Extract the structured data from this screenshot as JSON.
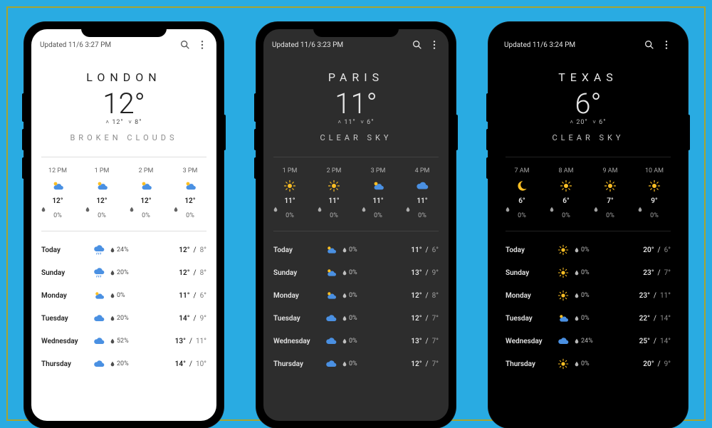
{
  "colors": {
    "bg": "#29abe2",
    "border": "#a8a430"
  },
  "phones": [
    {
      "theme": "light",
      "updated": "Updated 11/6 3:27 PM",
      "city": "LONDON",
      "temp": "12°",
      "hi": "12°",
      "lo": "8°",
      "condition": "BROKEN CLOUDS",
      "hourly": [
        {
          "time": "12 PM",
          "icon": "partly",
          "temp": "12°",
          "precip": "0%"
        },
        {
          "time": "1 PM",
          "icon": "partly",
          "temp": "12°",
          "precip": "0%"
        },
        {
          "time": "2 PM",
          "icon": "partly",
          "temp": "12°",
          "precip": "0%"
        },
        {
          "time": "3 PM",
          "icon": "partly",
          "temp": "12°",
          "precip": "0%"
        }
      ],
      "daily": [
        {
          "day": "Today",
          "icon": "rain",
          "precip": "24%",
          "hi": "12°",
          "lo": "8°"
        },
        {
          "day": "Sunday",
          "icon": "rain",
          "precip": "20%",
          "hi": "12°",
          "lo": "8°"
        },
        {
          "day": "Monday",
          "icon": "partly",
          "precip": "0%",
          "hi": "11°",
          "lo": "6°"
        },
        {
          "day": "Tuesday",
          "icon": "cloud",
          "precip": "20%",
          "hi": "14°",
          "lo": "9°"
        },
        {
          "day": "Wednesday",
          "icon": "cloud",
          "precip": "52%",
          "hi": "13°",
          "lo": "11°"
        },
        {
          "day": "Thursday",
          "icon": "cloud",
          "precip": "20%",
          "hi": "14°",
          "lo": "10°"
        }
      ]
    },
    {
      "theme": "dark",
      "updated": "Updated 11/6 3:23 PM",
      "city": "PARIS",
      "temp": "11°",
      "hi": "11°",
      "lo": "6°",
      "condition": "CLEAR SKY",
      "hourly": [
        {
          "time": "1 PM",
          "icon": "sun",
          "temp": "11°",
          "precip": "0%"
        },
        {
          "time": "2 PM",
          "icon": "sun",
          "temp": "11°",
          "precip": "0%"
        },
        {
          "time": "3 PM",
          "icon": "partly",
          "temp": "11°",
          "precip": "0%"
        },
        {
          "time": "4 PM",
          "icon": "cloud",
          "temp": "11°",
          "precip": "0%"
        }
      ],
      "daily": [
        {
          "day": "Today",
          "icon": "partly",
          "precip": "0%",
          "hi": "11°",
          "lo": "6°"
        },
        {
          "day": "Sunday",
          "icon": "partly",
          "precip": "0%",
          "hi": "13°",
          "lo": "9°"
        },
        {
          "day": "Monday",
          "icon": "partly",
          "precip": "0%",
          "hi": "12°",
          "lo": "8°"
        },
        {
          "day": "Tuesday",
          "icon": "cloud",
          "precip": "0%",
          "hi": "12°",
          "lo": "7°"
        },
        {
          "day": "Wednesday",
          "icon": "cloud",
          "precip": "0%",
          "hi": "13°",
          "lo": "7°"
        },
        {
          "day": "Thursday",
          "icon": "cloud",
          "precip": "0%",
          "hi": "12°",
          "lo": "7°"
        }
      ]
    },
    {
      "theme": "black",
      "updated": "Updated 11/6 3:24 PM",
      "city": "TEXAS",
      "temp": "6°",
      "hi": "20°",
      "lo": "6°",
      "condition": "CLEAR SKY",
      "hourly": [
        {
          "time": "7 AM",
          "icon": "moon",
          "temp": "6°",
          "precip": "0%"
        },
        {
          "time": "8 AM",
          "icon": "sun",
          "temp": "6°",
          "precip": "0%"
        },
        {
          "time": "9 AM",
          "icon": "sun",
          "temp": "7°",
          "precip": "0%"
        },
        {
          "time": "10 AM",
          "icon": "sun",
          "temp": "9°",
          "precip": "0%"
        }
      ],
      "daily": [
        {
          "day": "Today",
          "icon": "sun",
          "precip": "0%",
          "hi": "20°",
          "lo": "6°"
        },
        {
          "day": "Sunday",
          "icon": "sun",
          "precip": "0%",
          "hi": "23°",
          "lo": "7°"
        },
        {
          "day": "Monday",
          "icon": "sun",
          "precip": "0%",
          "hi": "23°",
          "lo": "11°"
        },
        {
          "day": "Tuesday",
          "icon": "partly",
          "precip": "0%",
          "hi": "22°",
          "lo": "14°"
        },
        {
          "day": "Wednesday",
          "icon": "cloud",
          "precip": "24%",
          "hi": "25°",
          "lo": "14°"
        },
        {
          "day": "Thursday",
          "icon": "sun",
          "precip": "0%",
          "hi": "20°",
          "lo": "9°"
        }
      ]
    }
  ]
}
